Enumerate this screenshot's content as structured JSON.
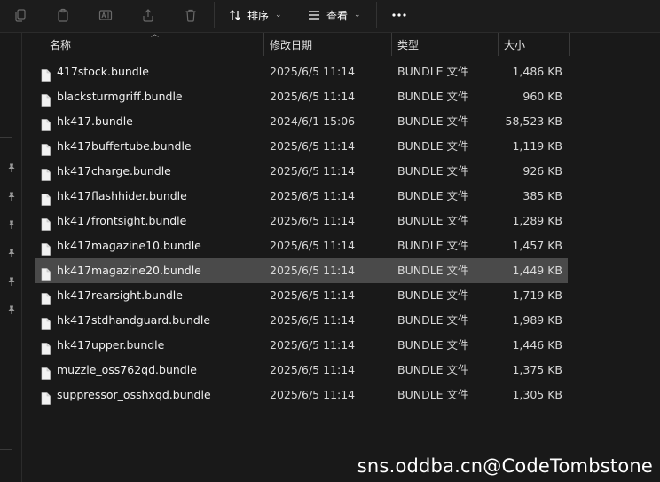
{
  "toolbar": {
    "sort_label": "排序",
    "view_label": "查看"
  },
  "columns": {
    "name": "名称",
    "date": "修改日期",
    "type": "类型",
    "size": "大小"
  },
  "files": [
    {
      "name": "417stock.bundle",
      "date": "2025/6/5 11:14",
      "type": "BUNDLE 文件",
      "size": "1,486 KB"
    },
    {
      "name": "blacksturmgriff.bundle",
      "date": "2025/6/5 11:14",
      "type": "BUNDLE 文件",
      "size": "960 KB"
    },
    {
      "name": "hk417.bundle",
      "date": "2024/6/1 15:06",
      "type": "BUNDLE 文件",
      "size": "58,523 KB"
    },
    {
      "name": "hk417buffertube.bundle",
      "date": "2025/6/5 11:14",
      "type": "BUNDLE 文件",
      "size": "1,119 KB"
    },
    {
      "name": "hk417charge.bundle",
      "date": "2025/6/5 11:14",
      "type": "BUNDLE 文件",
      "size": "926 KB"
    },
    {
      "name": "hk417flashhider.bundle",
      "date": "2025/6/5 11:14",
      "type": "BUNDLE 文件",
      "size": "385 KB"
    },
    {
      "name": "hk417frontsight.bundle",
      "date": "2025/6/5 11:14",
      "type": "BUNDLE 文件",
      "size": "1,289 KB"
    },
    {
      "name": "hk417magazine10.bundle",
      "date": "2025/6/5 11:14",
      "type": "BUNDLE 文件",
      "size": "1,457 KB"
    },
    {
      "name": "hk417magazine20.bundle",
      "date": "2025/6/5 11:14",
      "type": "BUNDLE 文件",
      "size": "1,449 KB"
    },
    {
      "name": "hk417rearsight.bundle",
      "date": "2025/6/5 11:14",
      "type": "BUNDLE 文件",
      "size": "1,719 KB"
    },
    {
      "name": "hk417stdhandguard.bundle",
      "date": "2025/6/5 11:14",
      "type": "BUNDLE 文件",
      "size": "1,989 KB"
    },
    {
      "name": "hk417upper.bundle",
      "date": "2025/6/5 11:14",
      "type": "BUNDLE 文件",
      "size": "1,446 KB"
    },
    {
      "name": "muzzle_oss762qd.bundle",
      "date": "2025/6/5 11:14",
      "type": "BUNDLE 文件",
      "size": "1,375 KB"
    },
    {
      "name": "suppressor_osshxqd.bundle",
      "date": "2025/6/5 11:14",
      "type": "BUNDLE 文件",
      "size": "1,305 KB"
    }
  ],
  "selected_index": 8,
  "watermark": "sns.oddba.cn@CodeTombstone",
  "colors": {
    "background": "#191919",
    "selected_row": "#4a4a4a"
  }
}
